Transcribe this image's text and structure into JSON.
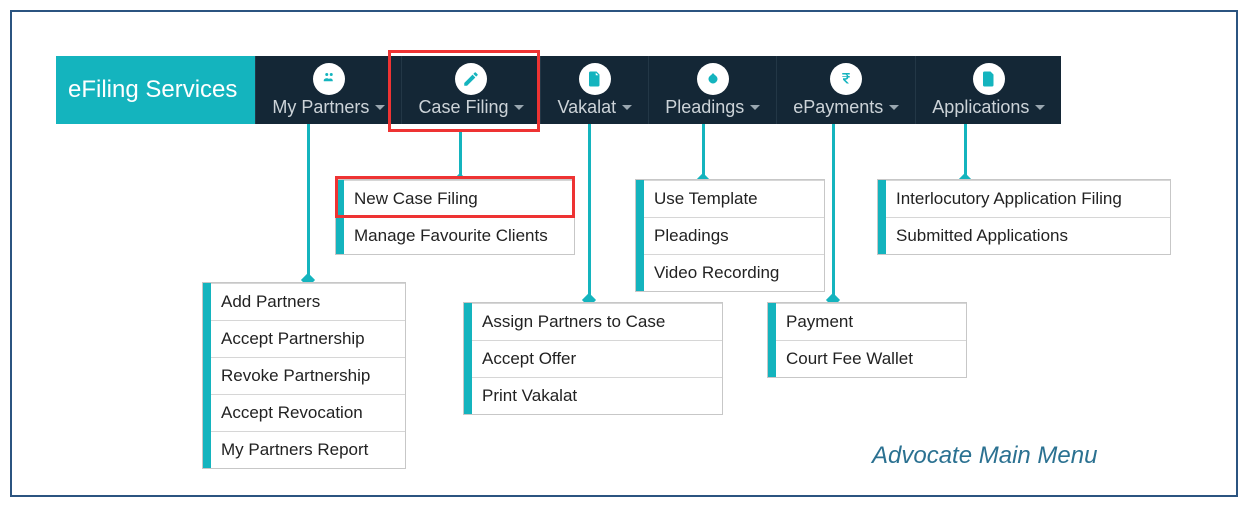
{
  "brand": "eFiling Services",
  "nav": [
    {
      "label": "My Partners"
    },
    {
      "label": "Case Filing"
    },
    {
      "label": "Vakalat"
    },
    {
      "label": "Pleadings"
    },
    {
      "label": "ePayments"
    },
    {
      "label": "Applications"
    }
  ],
  "menus": {
    "my_partners": [
      "Add Partners",
      "Accept Partnership",
      "Revoke Partnership",
      "Accept Revocation",
      "My Partners Report"
    ],
    "case_filing": [
      "New Case Filing",
      "Manage Favourite Clients"
    ],
    "vakalat": [
      "Assign Partners to Case",
      "Accept Offer",
      "Print Vakalat"
    ],
    "pleadings": [
      "Use Template",
      "Pleadings",
      "Video Recording"
    ],
    "epayments": [
      "Payment",
      "Court Fee Wallet"
    ],
    "applications": [
      "Interlocutory Application Filing",
      "Submitted Applications"
    ]
  },
  "caption": "Advocate Main Menu"
}
